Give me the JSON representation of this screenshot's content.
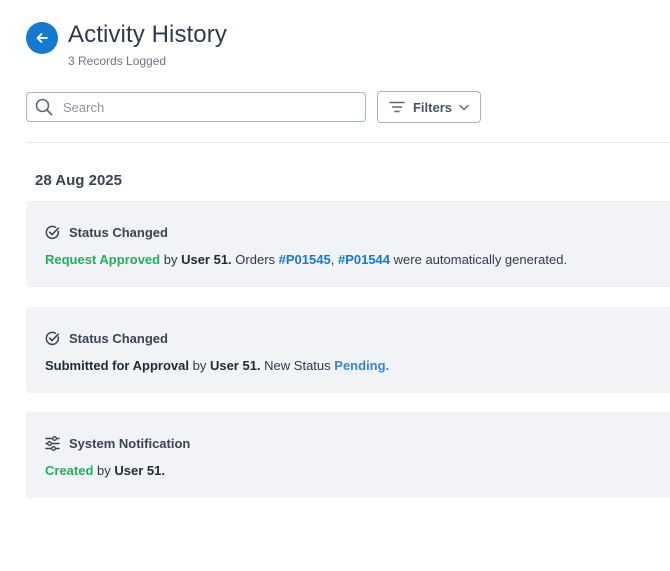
{
  "header": {
    "title": "Activity History",
    "record_count": "3 Records Logged"
  },
  "toolbar": {
    "search_placeholder": "Search",
    "filters_label": "Filters"
  },
  "date_group": "28 Aug 2025",
  "activities": [
    {
      "icon": "check-circle-icon",
      "title": "Status Changed",
      "action": "Request Approved",
      "by": "by",
      "user": "User 51.",
      "text1": "Orders",
      "order1": "#P01545",
      "sep": ",",
      "order2": "#P01544",
      "text2": "were automatically generated."
    },
    {
      "icon": "check-circle-icon",
      "title": "Status Changed",
      "action": "Submitted for Approval",
      "by": "by",
      "user": "User 51.",
      "text1": "New Status",
      "status": "Pending."
    },
    {
      "icon": "sliders-icon",
      "title": "System Notification",
      "action": "Created",
      "by": "by",
      "user": "User 51."
    }
  ],
  "colors": {
    "accent": "#1479d1",
    "success": "#20b15a",
    "status_pending": "#3a86cc",
    "card_bg": "#f1f3f6"
  }
}
